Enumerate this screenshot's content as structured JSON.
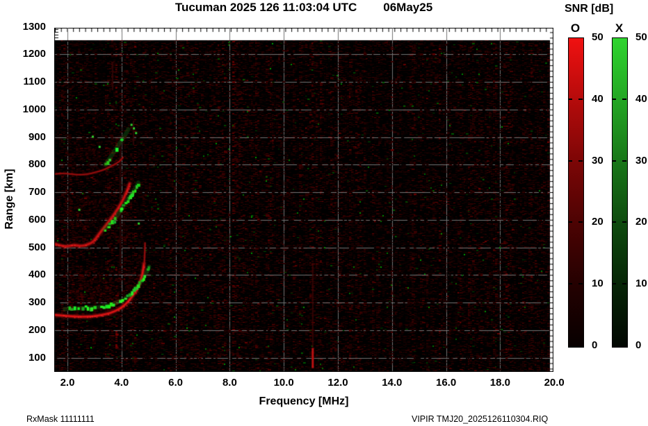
{
  "title": {
    "main": "Tucuman 2025 126 11:03:04 UTC",
    "date": "06May25"
  },
  "colorbar": {
    "title": "SNR [dB]",
    "bars": [
      {
        "label": "O",
        "top_color": "#f01111"
      },
      {
        "label": "X",
        "top_color": "#2fd42f"
      }
    ],
    "ticks": [
      "50",
      "40",
      "30",
      "20",
      "10",
      "0"
    ]
  },
  "axes": {
    "xlabel": "Frequency [MHz]",
    "ylabel": "Range [km]",
    "x_ticks": [
      "2.0",
      "4.0",
      "6.0",
      "8.0",
      "10.0",
      "12.0",
      "14.0",
      "16.0",
      "18.0",
      "20.0"
    ],
    "y_ticks": [
      "1300",
      "1200",
      "1100",
      "1000",
      "900",
      "800",
      "700",
      "600",
      "500",
      "400",
      "300",
      "200",
      "100"
    ]
  },
  "footer": {
    "left": "RxMask 11111111",
    "right": "VIPIR  TMJ20_2025126110304.RIQ"
  },
  "chart_data": {
    "type": "heatmap",
    "title": "Tucuman 2025 126 11:03:04 UTC 06May25",
    "description": "VIPIR ionogram: echo SNR versus sounding frequency and virtual range. O-mode echoes red, X-mode echoes green, on black noise background with gray grid.",
    "x_axis": {
      "label": "Frequency [MHz]",
      "min": 1.55,
      "max": 19.85,
      "grid_step": 2.0
    },
    "y_axis": {
      "label": "Range [km]",
      "min": 50,
      "max": 1300,
      "grid_step": 100
    },
    "snr_scale": {
      "label": "SNR [dB]",
      "min": 0,
      "max": 50,
      "o_color": "red",
      "x_color": "green"
    },
    "grid": {
      "on": true,
      "color": "#747474"
    },
    "traces": [
      {
        "name": "F 1st hop O-mode",
        "mode": "O",
        "style": "line",
        "color": "#d81414",
        "points": [
          [
            1.55,
            255
          ],
          [
            2.0,
            251
          ],
          [
            2.4,
            248
          ],
          [
            2.9,
            249
          ],
          [
            3.3,
            255
          ],
          [
            3.6,
            262
          ],
          [
            3.9,
            275
          ],
          [
            4.15,
            293
          ],
          [
            4.35,
            316
          ],
          [
            4.55,
            344
          ],
          [
            4.68,
            372
          ],
          [
            4.78,
            404
          ],
          [
            4.83,
            440
          ]
        ]
      },
      {
        "name": "F 1st hop O-mode spread tail",
        "mode": "O",
        "style": "thin",
        "color": "#a00f0f",
        "points": [
          [
            4.84,
            440
          ],
          [
            4.86,
            478
          ],
          [
            4.87,
            516
          ]
        ]
      },
      {
        "name": "F 1st hop X-mode",
        "mode": "X",
        "style": "chunks",
        "color": "#2ad42a",
        "points": [
          [
            1.9,
            276
          ],
          [
            2.4,
            279
          ],
          [
            2.9,
            281
          ],
          [
            3.4,
            287
          ],
          [
            3.75,
            296
          ],
          [
            4.1,
            311
          ],
          [
            4.4,
            336
          ],
          [
            4.6,
            359
          ],
          [
            4.78,
            383
          ],
          [
            4.93,
            409
          ],
          [
            5.02,
            430
          ]
        ]
      },
      {
        "name": "F 2nd hop O-mode",
        "mode": "O",
        "style": "line",
        "color": "#c01010",
        "points": [
          [
            1.55,
            512
          ],
          [
            1.75,
            506
          ],
          [
            2.0,
            503
          ],
          [
            2.25,
            509
          ],
          [
            2.5,
            504
          ],
          [
            2.75,
            510
          ],
          [
            2.95,
            519
          ],
          [
            3.15,
            546
          ],
          [
            3.35,
            571
          ],
          [
            3.55,
            596
          ],
          [
            3.75,
            623
          ],
          [
            3.95,
            653
          ],
          [
            4.1,
            681
          ],
          [
            4.22,
            709
          ],
          [
            4.3,
            731
          ]
        ]
      },
      {
        "name": "F 2nd hop X-mode",
        "mode": "X",
        "style": "chunks",
        "color": "#25cc25",
        "points": [
          [
            3.36,
            564
          ],
          [
            3.55,
            583
          ],
          [
            3.75,
            602
          ],
          [
            4.0,
            639
          ],
          [
            4.2,
            669
          ],
          [
            4.39,
            696
          ],
          [
            4.52,
            716
          ],
          [
            4.62,
            735
          ]
        ]
      },
      {
        "name": "F 3rd hop O-mode",
        "mode": "O",
        "style": "faint",
        "color": "#990d0d",
        "points": [
          [
            1.55,
            766
          ],
          [
            1.9,
            769
          ],
          [
            2.3,
            763
          ],
          [
            2.7,
            764
          ],
          [
            3.0,
            771
          ],
          [
            3.35,
            781
          ],
          [
            3.7,
            798
          ],
          [
            3.95,
            813
          ],
          [
            4.05,
            826
          ]
        ]
      },
      {
        "name": "F 3rd hop X-mode",
        "mode": "X",
        "style": "dashes",
        "color": "#1fb51f",
        "points": [
          [
            3.4,
            800
          ],
          [
            3.6,
            828
          ],
          [
            3.8,
            858
          ],
          [
            4.0,
            888
          ],
          [
            4.15,
            910
          ],
          [
            4.25,
            928
          ]
        ]
      }
    ],
    "interference_streaks": [
      {
        "freq": 11.07,
        "km_lo": 62,
        "km_hi": 135,
        "width": 3,
        "color": "#c41111",
        "alpha": 0.95
      },
      {
        "freq": 11.07,
        "km_lo": 135,
        "km_hi": 445,
        "width": 2,
        "color": "#3a0505",
        "alpha": 0.85
      },
      {
        "freq": 3.95,
        "km_lo": 430,
        "km_hi": 890,
        "width": 2,
        "color": "#2a0404",
        "alpha": 0.9
      },
      {
        "freq": 3.67,
        "km_lo": 1070,
        "km_hi": 1170,
        "width": 2,
        "color": "#300505",
        "alpha": 0.9
      },
      {
        "freq": 4.44,
        "km_lo": 870,
        "km_hi": 960,
        "width": 2,
        "color": "#320606",
        "alpha": 0.9
      }
    ],
    "green_specks": [
      [
        4.42,
        935
      ],
      [
        4.33,
        948
      ],
      [
        4.5,
        918
      ],
      [
        2.9,
        905
      ],
      [
        3.15,
        868
      ],
      [
        4.6,
        590
      ],
      [
        2.4,
        640
      ]
    ],
    "diffuse_regions": [
      {
        "f1": 2.0,
        "f2": 4.6,
        "km1": 255,
        "km2": 430,
        "dots": 520,
        "max_intensity": 70
      },
      {
        "f1": 1.9,
        "f2": 4.3,
        "km1": 515,
        "km2": 700,
        "dots": 420,
        "max_intensity": 60
      },
      {
        "f1": 1.9,
        "f2": 4.2,
        "km1": 765,
        "km2": 905,
        "dots": 260,
        "max_intensity": 50
      }
    ],
    "noise": {
      "seed": 1337,
      "dash_probability": 0.5,
      "green_probability": 0.007,
      "bright_red_probability": 0.015
    }
  }
}
